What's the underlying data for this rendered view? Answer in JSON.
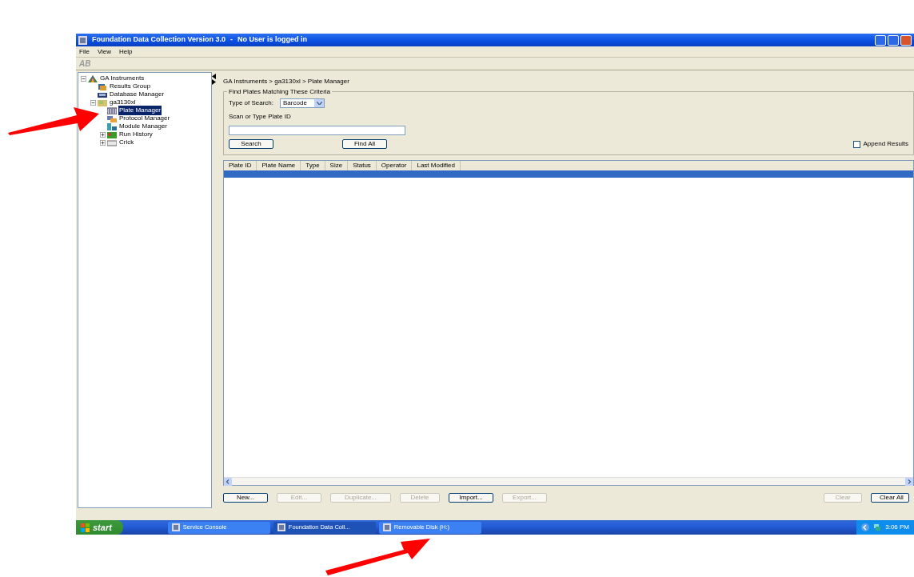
{
  "window": {
    "title": "Foundation Data Collection Version 3.0",
    "separator": "-",
    "user_status": "No User is logged in"
  },
  "menu": [
    "File",
    "View",
    "Help"
  ],
  "toolbar": {
    "logo": "AB"
  },
  "tree": [
    {
      "label": "GA Instruments",
      "kind": "instruments",
      "expanded": true,
      "selected": false,
      "children": [
        {
          "label": "Results Group",
          "kind": "results",
          "selected": false
        },
        {
          "label": "Database Manager",
          "kind": "database",
          "selected": false
        },
        {
          "label": "ga3130xl",
          "kind": "instrument",
          "expanded": true,
          "selected": false,
          "children": [
            {
              "label": "Plate Manager",
              "kind": "plate",
              "selected": true
            },
            {
              "label": "Protocol Manager",
              "kind": "protocol",
              "selected": false
            },
            {
              "label": "Module Manager",
              "kind": "module",
              "selected": false
            },
            {
              "label": "Run History",
              "kind": "history",
              "expanded": false,
              "selected": false
            },
            {
              "label": "Crick",
              "kind": "crick",
              "expanded": false,
              "selected": false
            }
          ]
        }
      ]
    }
  ],
  "breadcrumb": "GA Instruments > ga3130xl > Plate Manager",
  "criteria": {
    "title": "Find Plates Matching These Criteria",
    "type_label": "Type of Search:",
    "type_value": "Barcode",
    "scan_label": "Scan or Type Plate ID",
    "append": {
      "label": "Append Results",
      "checked": false
    }
  },
  "search_buttons": [
    "Search",
    "Find All"
  ],
  "table": {
    "columns": [
      "Plate ID",
      "Plate Name",
      "Type",
      "Size",
      "Status",
      "Operator",
      "Last Modified"
    ],
    "rows": [
      {
        "selected": true
      }
    ]
  },
  "actions": [
    {
      "label": "New...",
      "disabled": false
    },
    {
      "label": "Edit...",
      "disabled": true
    },
    {
      "label": "Duplicate...",
      "disabled": true
    },
    {
      "label": "Delete",
      "disabled": true
    },
    {
      "label": "Import...",
      "disabled": false
    },
    {
      "label": "Export...",
      "disabled": true
    }
  ],
  "clear_actions": [
    {
      "label": "Clear",
      "disabled": true
    },
    {
      "label": "Clear All",
      "disabled": false
    }
  ],
  "taskbar": {
    "start": "start",
    "tasks": [
      {
        "label": "Service Console",
        "active": false
      },
      {
        "label": "Foundation Data Coll...",
        "active": true
      },
      {
        "label": "Removable Disk (H:)",
        "active": false
      }
    ],
    "time": "3:06 PM"
  }
}
